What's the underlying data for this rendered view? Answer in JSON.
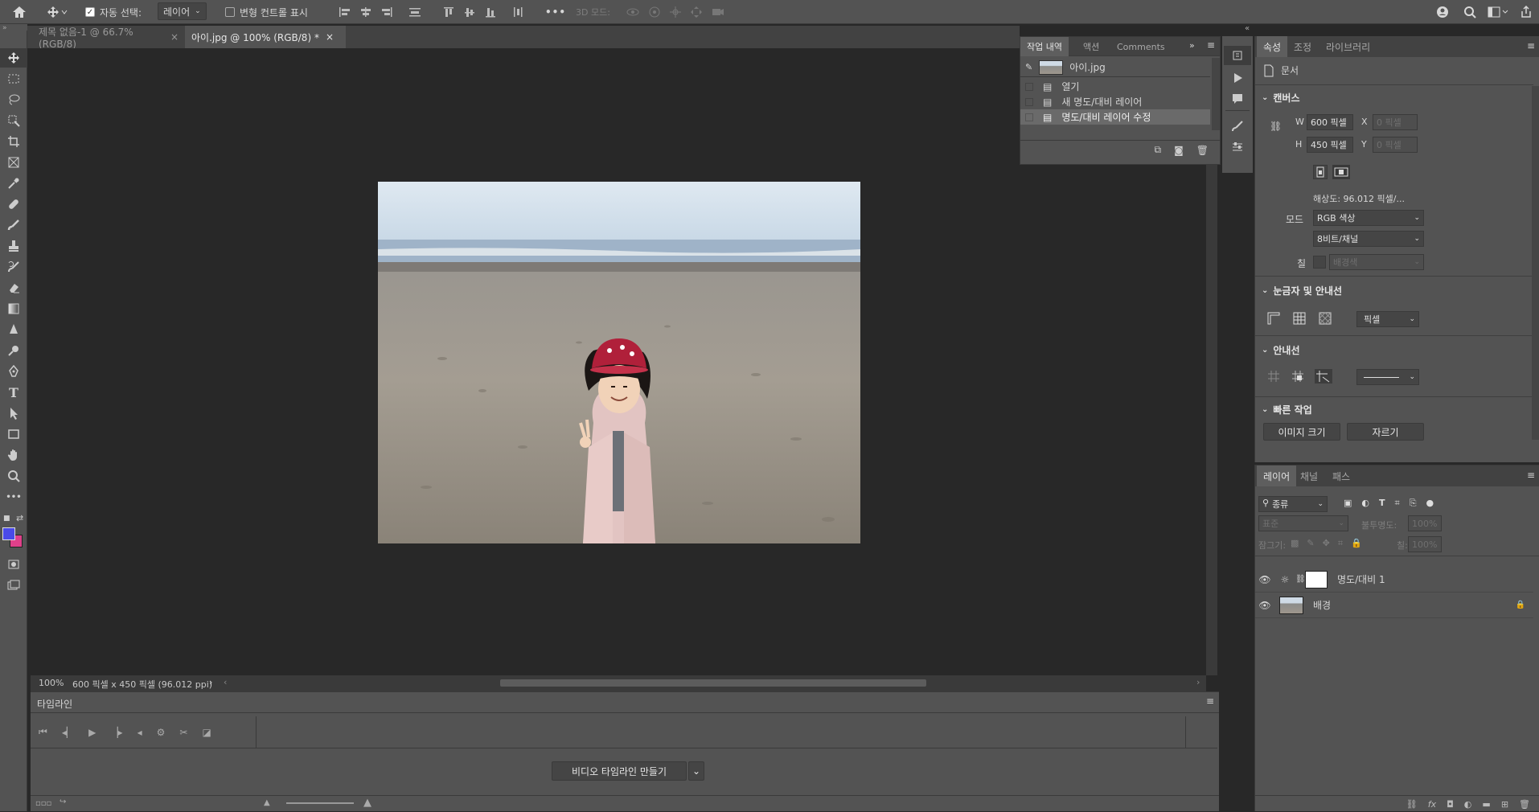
{
  "topbar": {
    "auto_select_label": "자동 선택:",
    "auto_select_value": "레이어",
    "transform_controls_label": "변형 컨트롤 표시",
    "mode3d_label": "3D 모드:",
    "more_label": "•••"
  },
  "tabs": [
    {
      "label": "제목 없음-1 @ 66.7% (RGB/8)",
      "active": false
    },
    {
      "label": "아이.jpg @ 100% (RGB/8) *",
      "active": true
    }
  ],
  "status": {
    "zoom": "100%",
    "info": "600 픽셀 x 450 픽셀 (96.012 ppi)"
  },
  "history_panel": {
    "tabs": [
      "작업 내역",
      "액션",
      "Comments"
    ],
    "snapshot": "아이.jpg",
    "items": [
      "열기",
      "새 명도/대비 레이어",
      "명도/대비 레이어 수정"
    ]
  },
  "properties": {
    "tabs": [
      "속성",
      "조정",
      "라이브러리"
    ],
    "doc_label": "문서",
    "canvas": {
      "title": "캔버스",
      "w_label": "W",
      "w_value": "600 픽셀",
      "h_label": "H",
      "h_value": "450 픽셀",
      "x_label": "X",
      "x_placeholder": "0 픽셀",
      "y_label": "Y",
      "y_placeholder": "0 픽셀",
      "resolution": "해상도: 96.012 픽셀/...",
      "mode_label": "모드",
      "mode_value": "RGB 색상",
      "bits_value": "8비트/채널",
      "fill_label": "칠",
      "fill_value": "배경색"
    },
    "rulers": {
      "title": "눈금자 및 안내선",
      "unit": "픽셀"
    },
    "guides": {
      "title": "안내선"
    },
    "quick_actions": {
      "title": "빠른 작업",
      "image_size": "이미지 크기",
      "crop": "자르기"
    }
  },
  "layers_panel": {
    "tabs": [
      "레이어",
      "채널",
      "패스"
    ],
    "filter_value": "종류",
    "blend_value": "표준",
    "opacity_label": "불투명도:",
    "opacity_value": "100%",
    "lock_label": "잠그기:",
    "fill_label": "칠:",
    "fill_value": "100%",
    "layers": [
      {
        "name": "명도/대비 1"
      },
      {
        "name": "배경"
      }
    ]
  },
  "timeline": {
    "title": "타임라인",
    "create_button": "비디오 타임라인 만들기"
  },
  "colors": {
    "foreground": "#4a4ae8",
    "background": "#e0408a"
  },
  "icons": {
    "home": "home-icon",
    "move": "move-icon",
    "search": "search-icon"
  }
}
